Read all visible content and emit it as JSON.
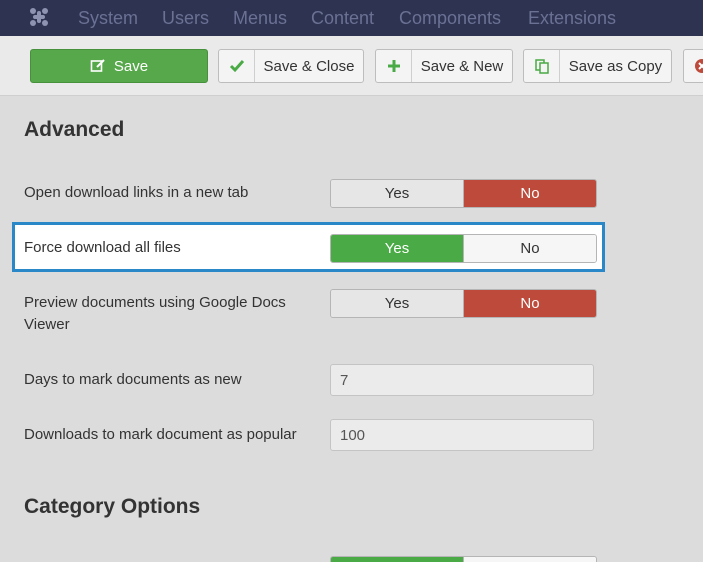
{
  "nav": {
    "items": [
      "System",
      "Users",
      "Menus",
      "Content",
      "Components",
      "Extensions"
    ]
  },
  "toolbar": {
    "save_label": "Save",
    "save_close_label": "Save & Close",
    "save_new_label": "Save & New",
    "save_copy_label": "Save as Copy"
  },
  "advanced": {
    "title": "Advanced",
    "fields": [
      {
        "label": "Open download links in a new tab",
        "yes": "Yes",
        "no": "No",
        "value": "No"
      },
      {
        "label": "Force download all files",
        "yes": "Yes",
        "no": "No",
        "value": "Yes"
      },
      {
        "label": "Preview documents using Google Docs Viewer",
        "yes": "Yes",
        "no": "No",
        "value": "No"
      }
    ],
    "days_new": {
      "label": "Days to mark documents as new",
      "value": "7"
    },
    "downloads_popular": {
      "label": "Downloads to mark document as popular",
      "value": "100"
    }
  },
  "category": {
    "title": "Category Options"
  },
  "colors": {
    "nav_bg": "#2d3350",
    "save_green": "#56a84a",
    "no_red": "#bd4a3b",
    "yes_green": "#4aaa45",
    "highlight_blue": "#2a88c8"
  }
}
